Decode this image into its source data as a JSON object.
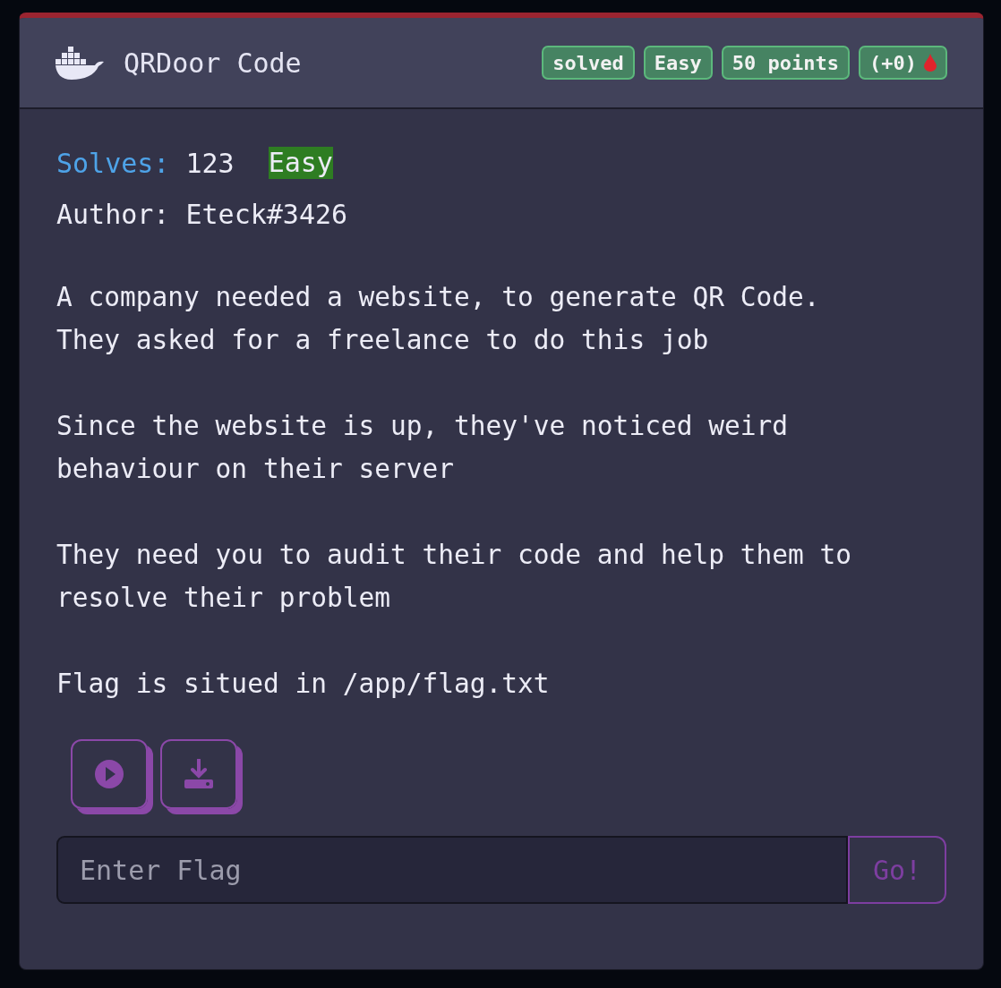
{
  "card": {
    "title": "QRDoor Code",
    "badges": [
      {
        "text": "solved",
        "kind": "plain"
      },
      {
        "text": "Easy",
        "kind": "plain"
      },
      {
        "text": "50 points",
        "kind": "plain"
      },
      {
        "text": "(+0)",
        "kind": "blood"
      }
    ],
    "solves_label": "Solves:",
    "solves": "123",
    "difficulty": "Easy",
    "author": "Author: Eteck#3426",
    "paragraphs": [
      "A company needed a website, to generate QR Code.\nThey asked for a freelance to do this job",
      "Since the website is up, they've noticed weird\nbehaviour on their server",
      "They need you to audit their code and help them to\nresolve their problem",
      "Flag is situed in /app/flag.txt"
    ],
    "actions": [
      {
        "kind": "start"
      },
      {
        "kind": "download"
      }
    ],
    "flag_field": {
      "placeholder": "Enter Flag"
    },
    "submit": "Go!"
  }
}
